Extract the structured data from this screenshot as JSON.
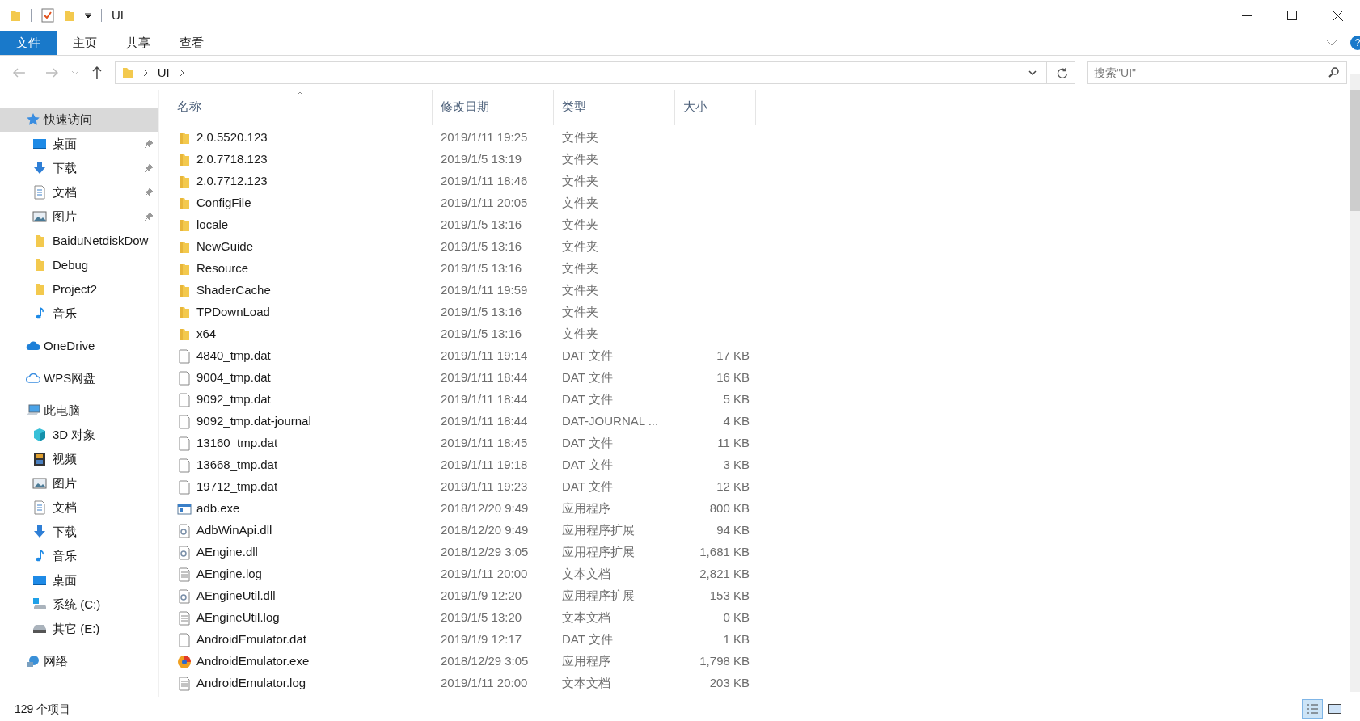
{
  "window": {
    "title": "UI"
  },
  "ribbon_tabs": [
    {
      "label": "文件",
      "selected": true
    },
    {
      "label": "主页",
      "selected": false
    },
    {
      "label": "共享",
      "selected": false
    },
    {
      "label": "查看",
      "selected": false
    }
  ],
  "help_button": {
    "label": "?"
  },
  "address": {
    "path": [
      "UI"
    ]
  },
  "search": {
    "placeholder": "搜索\"UI\""
  },
  "sidebar": {
    "items": [
      {
        "label": "快速访问",
        "kind": "star",
        "selected": true,
        "children": [
          {
            "label": "桌面",
            "kind": "desktop",
            "pinned": true
          },
          {
            "label": "下载",
            "kind": "download",
            "pinned": true
          },
          {
            "label": "文档",
            "kind": "document",
            "pinned": true
          },
          {
            "label": "图片",
            "kind": "image",
            "pinned": true
          },
          {
            "label": "BaiduNetdiskDow",
            "kind": "folder",
            "pinned": false
          },
          {
            "label": "Debug",
            "kind": "folder",
            "pinned": false
          },
          {
            "label": "Project2",
            "kind": "folder",
            "pinned": false
          },
          {
            "label": "音乐",
            "kind": "music",
            "pinned": false
          }
        ]
      },
      {
        "label": "OneDrive",
        "kind": "cloud",
        "selected": false
      },
      {
        "label": "WPS网盘",
        "kind": "cloud-outline",
        "selected": false
      },
      {
        "label": "此电脑",
        "kind": "computer",
        "selected": false,
        "children": [
          {
            "label": "3D 对象",
            "kind": "cube",
            "pinned": false
          },
          {
            "label": "视频",
            "kind": "film",
            "pinned": false
          },
          {
            "label": "图片",
            "kind": "image",
            "pinned": false
          },
          {
            "label": "文档",
            "kind": "document",
            "pinned": false
          },
          {
            "label": "下载",
            "kind": "download",
            "pinned": false
          },
          {
            "label": "音乐",
            "kind": "music",
            "pinned": false
          },
          {
            "label": "桌面",
            "kind": "desktop",
            "pinned": false
          },
          {
            "label": "系统 (C:)",
            "kind": "drive-windows",
            "pinned": false
          },
          {
            "label": "其它 (E:)",
            "kind": "drive",
            "pinned": false
          }
        ]
      },
      {
        "label": "网络",
        "kind": "network",
        "selected": false
      }
    ]
  },
  "table": {
    "columns": [
      "名称",
      "修改日期",
      "类型",
      "大小"
    ],
    "rows": [
      {
        "kind": "folder",
        "name": "2.0.5520.123",
        "date": "2019/1/11 19:25",
        "type": "文件夹"
      },
      {
        "kind": "folder",
        "name": "2.0.7718.123",
        "date": "2019/1/5 13:19",
        "type": "文件夹"
      },
      {
        "kind": "folder",
        "name": "2.0.7712.123",
        "date": "2019/1/11 18:46",
        "type": "文件夹"
      },
      {
        "kind": "folder",
        "name": "ConfigFile",
        "date": "2019/1/11 20:05",
        "type": "文件夹"
      },
      {
        "kind": "folder",
        "name": "locale",
        "date": "2019/1/5 13:16",
        "type": "文件夹"
      },
      {
        "kind": "folder",
        "name": "NewGuide",
        "date": "2019/1/5 13:16",
        "type": "文件夹"
      },
      {
        "kind": "folder",
        "name": "Resource",
        "date": "2019/1/5 13:16",
        "type": "文件夹"
      },
      {
        "kind": "folder",
        "name": "ShaderCache",
        "date": "2019/1/11 19:59",
        "type": "文件夹"
      },
      {
        "kind": "folder",
        "name": "TPDownLoad",
        "date": "2019/1/5 13:16",
        "type": "文件夹"
      },
      {
        "kind": "folder",
        "name": "x64",
        "date": "2019/1/5 13:16",
        "type": "文件夹"
      },
      {
        "kind": "file",
        "name": "4840_tmp.dat",
        "date": "2019/1/11 19:14",
        "type": "DAT 文件",
        "size": "17 KB"
      },
      {
        "kind": "file",
        "name": "9004_tmp.dat",
        "date": "2019/1/11 18:44",
        "type": "DAT 文件",
        "size": "16 KB"
      },
      {
        "kind": "file",
        "name": "9092_tmp.dat",
        "date": "2019/1/11 18:44",
        "type": "DAT 文件",
        "size": "5 KB"
      },
      {
        "kind": "file",
        "name": "9092_tmp.dat-journal",
        "date": "2019/1/11 18:44",
        "type": "DAT-JOURNAL ...",
        "size": "4 KB"
      },
      {
        "kind": "file",
        "name": "13160_tmp.dat",
        "date": "2019/1/11 18:45",
        "type": "DAT 文件",
        "size": "11 KB"
      },
      {
        "kind": "file",
        "name": "13668_tmp.dat",
        "date": "2019/1/11 19:18",
        "type": "DAT 文件",
        "size": "3 KB"
      },
      {
        "kind": "file",
        "name": "19712_tmp.dat",
        "date": "2019/1/11 19:23",
        "type": "DAT 文件",
        "size": "12 KB"
      },
      {
        "kind": "exe",
        "name": "adb.exe",
        "date": "2018/12/20 9:49",
        "type": "应用程序",
        "size": "800 KB"
      },
      {
        "kind": "dll",
        "name": "AdbWinApi.dll",
        "date": "2018/12/20 9:49",
        "type": "应用程序扩展",
        "size": "94 KB"
      },
      {
        "kind": "dll",
        "name": "AEngine.dll",
        "date": "2018/12/29 3:05",
        "type": "应用程序扩展",
        "size": "1,681 KB"
      },
      {
        "kind": "text",
        "name": "AEngine.log",
        "date": "2019/1/11 20:00",
        "type": "文本文档",
        "size": "2,821 KB"
      },
      {
        "kind": "dll",
        "name": "AEngineUtil.dll",
        "date": "2019/1/9 12:20",
        "type": "应用程序扩展",
        "size": "153 KB"
      },
      {
        "kind": "text",
        "name": "AEngineUtil.log",
        "date": "2019/1/5 13:20",
        "type": "文本文档",
        "size": "0 KB"
      },
      {
        "kind": "file",
        "name": "AndroidEmulator.dat",
        "date": "2019/1/9 12:17",
        "type": "DAT 文件",
        "size": "1 KB"
      },
      {
        "kind": "app",
        "name": "AndroidEmulator.exe",
        "date": "2018/12/29 3:05",
        "type": "应用程序",
        "size": "1,798 KB"
      },
      {
        "kind": "text",
        "name": "AndroidEmulator.log",
        "date": "2019/1/11 20:00",
        "type": "文本文档",
        "size": "203 KB"
      }
    ]
  },
  "status_bar": {
    "count": "129 个项目"
  }
}
